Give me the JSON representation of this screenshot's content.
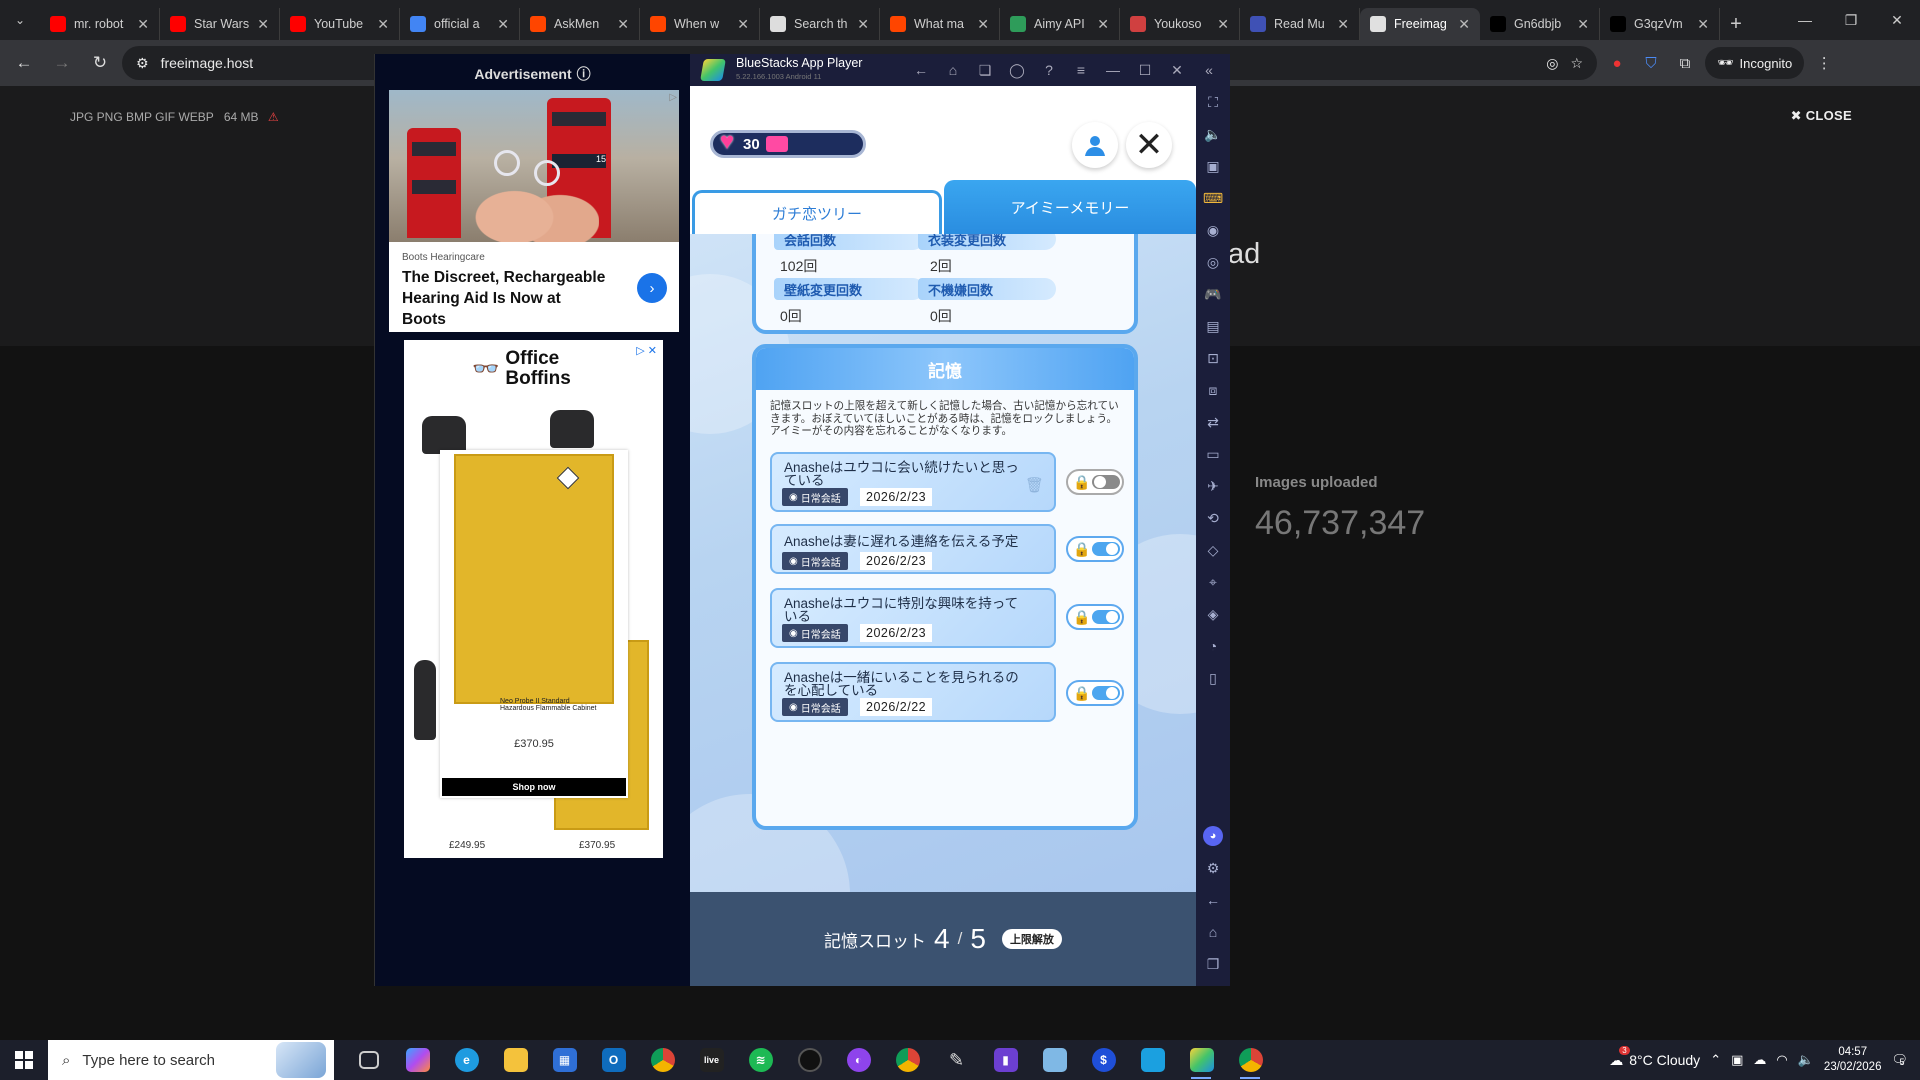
{
  "browser": {
    "tabs": [
      {
        "title": "mr. robot",
        "favicon": "youtube-icon",
        "color": "#ff0000"
      },
      {
        "title": "Star Wars",
        "favicon": "youtube-icon",
        "color": "#ff0000"
      },
      {
        "title": "YouTube",
        "favicon": "youtube-icon",
        "color": "#ff0000"
      },
      {
        "title": "official a",
        "favicon": "google-icon",
        "color": "#4285f4"
      },
      {
        "title": "AskMen",
        "favicon": "reddit-icon",
        "color": "#ff4500"
      },
      {
        "title": "When w",
        "favicon": "reddit-icon",
        "color": "#ff4500"
      },
      {
        "title": "Search th",
        "favicon": "doc-icon",
        "color": "#dddddd"
      },
      {
        "title": "What ma",
        "favicon": "reddit-icon",
        "color": "#ff4500"
      },
      {
        "title": "Aimy API",
        "favicon": "aimy-icon",
        "color": "#2e9c5a"
      },
      {
        "title": "Youkoso",
        "favicon": "youkoso-icon",
        "color": "#d04040"
      },
      {
        "title": "Read Mu",
        "favicon": "read-icon",
        "color": "#3f51b5"
      },
      {
        "title": "Freeimag",
        "favicon": "freeimage-icon",
        "color": "#e0e0e0",
        "active": true
      },
      {
        "title": "Gn6dbjb",
        "favicon": "x-icon",
        "color": "#000000"
      },
      {
        "title": "G3qzVm",
        "favicon": "x-icon",
        "color": "#000000"
      }
    ],
    "url": "freeimage.host",
    "incognito_label": "Incognito"
  },
  "freeimage": {
    "formats_note": "JPG PNG BMP GIF WEBP",
    "max_size": "64 MB",
    "close_label": "CLOSE",
    "upload_fragment": "ad",
    "images_uploaded_label": "Images uploaded",
    "images_uploaded_value": "46,737,347"
  },
  "ads": {
    "header": "Advertisement",
    "ad1": {
      "bus_route": "15",
      "brand": "Boots Hearingcare",
      "headline": "The Discreet, Rechargeable Hearing Aid Is Now at Boots"
    },
    "ad2": {
      "logo_line1": "Office",
      "logo_line2": "Boffins",
      "product_caption": "Neo Probe II Standard Hazardous Flammable Cabinet",
      "product_price": "£370.95",
      "cta": "Shop now",
      "price_left": "£249.95",
      "price_right": "£370.95"
    }
  },
  "bluestacks": {
    "title": "BlueStacks App Player",
    "version": "5.22.166.1003  Android 11"
  },
  "game": {
    "hearts": "30",
    "hearts_level": 0.18,
    "tab_tree": "ガチ恋ツリー",
    "tab_memory": "アイミーメモリー",
    "stats": [
      {
        "label": "会話回数",
        "value": "102回"
      },
      {
        "label": "衣装変更回数",
        "value": "2回"
      },
      {
        "label": "壁紙変更回数",
        "value": "0回"
      },
      {
        "label": "不機嫌回数",
        "value": "0回"
      }
    ],
    "memory_title": "記憶",
    "memory_desc": "記憶スロットの上限を超えて新しく記憶した場合、古い記憶から忘れていきます。おぼえていてほしいことがある時は、記憶をロックしましょう。アイミーがその内容を忘れることがなくなります。",
    "memories": [
      {
        "text": "Anasheはユウコに会い続けたいと思っている",
        "category": "日常会話",
        "date": "2026/2/23",
        "locked": false
      },
      {
        "text": "Anasheは妻に遅れる連絡を伝える予定",
        "category": "日常会話",
        "date": "2026/2/23",
        "locked": true
      },
      {
        "text": "Anasheはユウコに特別な興味を持っている",
        "category": "日常会話",
        "date": "2026/2/23",
        "locked": true
      },
      {
        "text": "Anasheは一緒にいることを見られるのを心配している",
        "category": "日常会話",
        "date": "2026/2/22",
        "locked": true
      }
    ],
    "slot_label": "記憶スロット",
    "slot_used": "4",
    "slot_sep": "/",
    "slot_total": "5",
    "slot_unlock": "上限解放"
  },
  "taskbar": {
    "search_placeholder": "Type here to search",
    "weather": "8°C  Cloudy",
    "weather_badge": "3",
    "time": "04:57",
    "date": "23/02/2026",
    "notifications": "5"
  }
}
